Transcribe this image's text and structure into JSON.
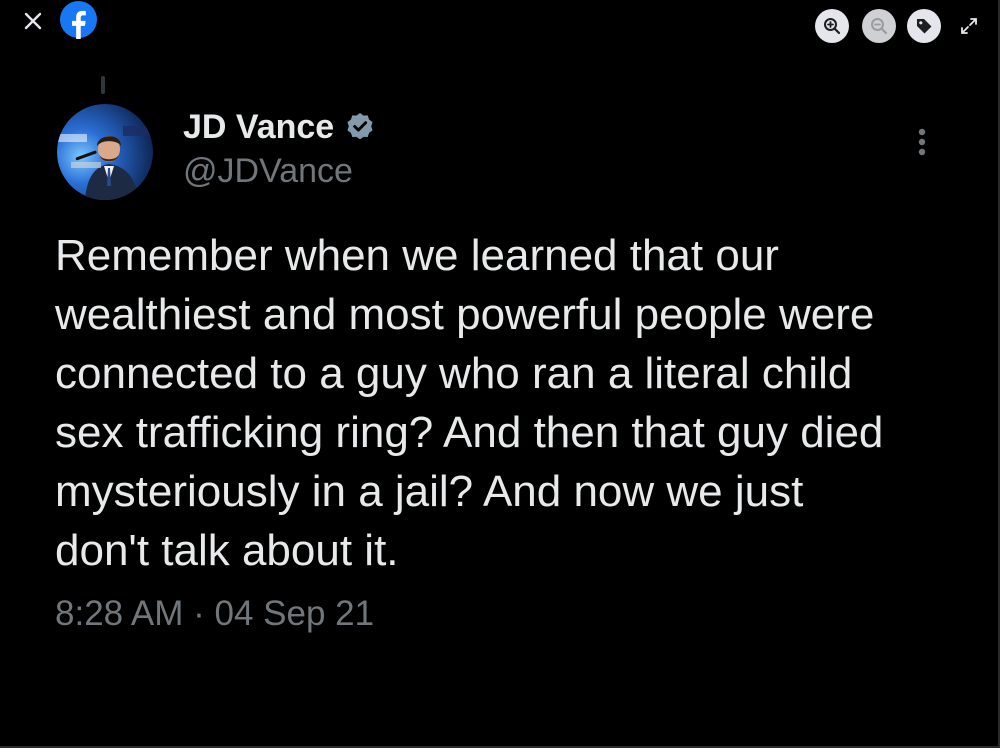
{
  "viewer": {
    "close_icon": "close-icon",
    "brand_icon": "facebook-logo",
    "tools": [
      {
        "name": "zoom-in",
        "icon": "zoom-in-icon"
      },
      {
        "name": "zoom-out",
        "icon": "zoom-out-icon"
      },
      {
        "name": "tag",
        "icon": "tag-icon"
      },
      {
        "name": "fullscreen",
        "icon": "expand-icon"
      }
    ]
  },
  "tweet": {
    "display_name": "JD Vance",
    "handle": "@JDVance",
    "text": "Remember when we learned that our\nwealthiest and most powerful people were\nconnected to a guy who ran a literal child\nsex trafficking ring? And then that guy died\nmysteriously in a jail? And now we just\ndon't talk about it.",
    "time": "8:28 AM",
    "separator": " · ",
    "date": "04 Sep 21"
  },
  "colors": {
    "background": "#000000",
    "text_primary": "#e7e9ea",
    "text_secondary": "#71767b",
    "facebook_blue": "#1877f2",
    "tool_button_bg": "#e4e6eb"
  }
}
